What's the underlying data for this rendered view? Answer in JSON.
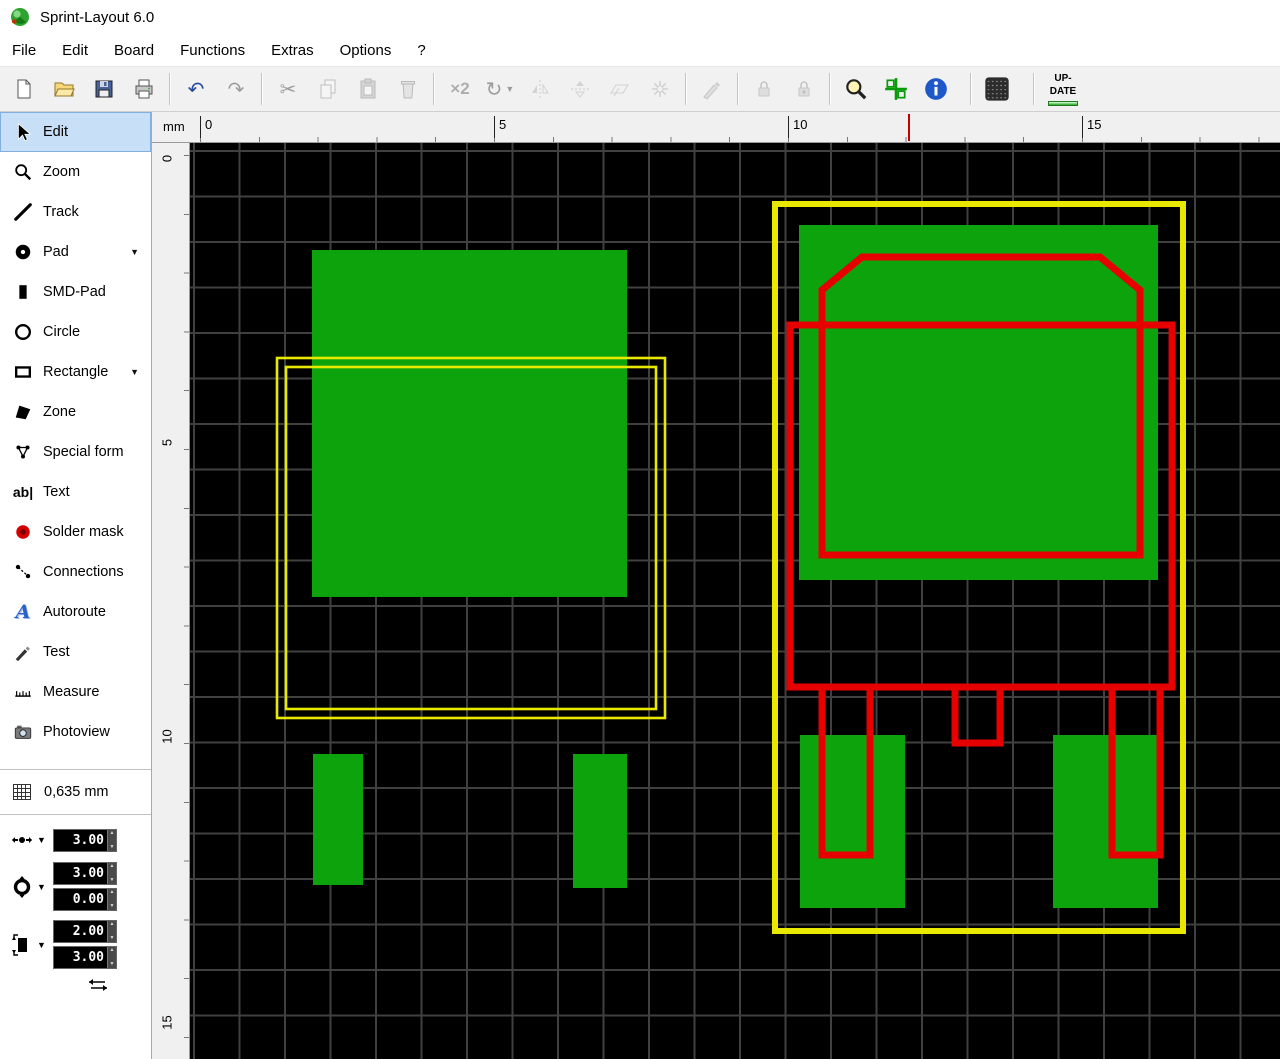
{
  "window": {
    "title": "Sprint-Layout 6.0"
  },
  "menu": {
    "items": [
      "File",
      "Edit",
      "Board",
      "Functions",
      "Extras",
      "Options",
      "?"
    ]
  },
  "toolbar": {
    "undo_glyph": "↶",
    "redo_glyph": "↷",
    "cut_glyph": "✂",
    "duplicate_label": "×2",
    "rotate_glyph": "↻",
    "update_top": "UP-",
    "update_bottom": "DATE"
  },
  "icons": {
    "dropdown": "▼",
    "spin_up": "▲",
    "spin_down": "▼"
  },
  "sidebar": {
    "items": [
      {
        "label": "Edit"
      },
      {
        "label": "Zoom"
      },
      {
        "label": "Track"
      },
      {
        "label": "Pad"
      },
      {
        "label": "SMD-Pad"
      },
      {
        "label": "Circle"
      },
      {
        "label": "Rectangle"
      },
      {
        "label": "Zone"
      },
      {
        "label": "Special form"
      },
      {
        "label": "Text"
      },
      {
        "label": "Solder mask"
      },
      {
        "label": "Connections"
      },
      {
        "label": "Autoroute"
      },
      {
        "label": "Test"
      },
      {
        "label": "Measure"
      },
      {
        "label": "Photoview"
      }
    ],
    "text_icon_label": "ab|",
    "autoroute_icon_label": "A",
    "grid_label": "0,635 mm",
    "params": {
      "track_width": "3.00",
      "pad_outer": "3.00",
      "pad_drill": "0.00",
      "smd_width": "2.00",
      "smd_height": "3.00"
    }
  },
  "rulers": {
    "unit": "mm",
    "h_labels": [
      "0",
      "5",
      "10",
      "15"
    ],
    "v_labels": [
      "0",
      "5",
      "10",
      "15"
    ]
  },
  "colors": {
    "copper_green": "#0CA30C",
    "silk_yellow": "#E9E900",
    "outline_red": "#E60000"
  }
}
